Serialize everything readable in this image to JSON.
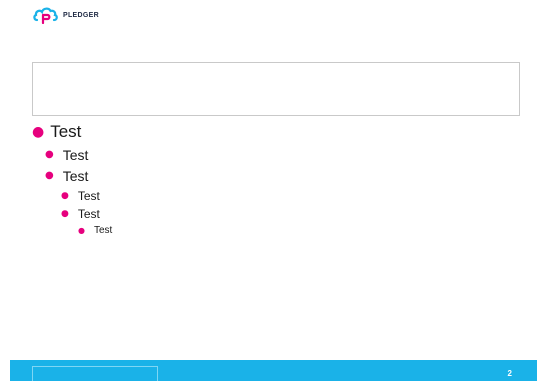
{
  "header": {
    "logo_text": "PLEDGER",
    "logo_icon": "pledger-cloud-logo-icon"
  },
  "title_placeholder": {
    "text": ""
  },
  "bullets": [
    {
      "level": 1,
      "text": "Test"
    },
    {
      "level": 2,
      "text": "Test"
    },
    {
      "level": 2,
      "text": "Test"
    },
    {
      "level": 3,
      "text": "Test"
    },
    {
      "level": 3,
      "text": "Test"
    },
    {
      "level": 4,
      "text": "Test"
    }
  ],
  "footer": {
    "page_number": "2"
  },
  "colors": {
    "bullet": "#e6007e",
    "footer_bar": "#1ab2e8",
    "logo_pink": "#e6007e",
    "logo_blue": "#1ab2e8"
  }
}
